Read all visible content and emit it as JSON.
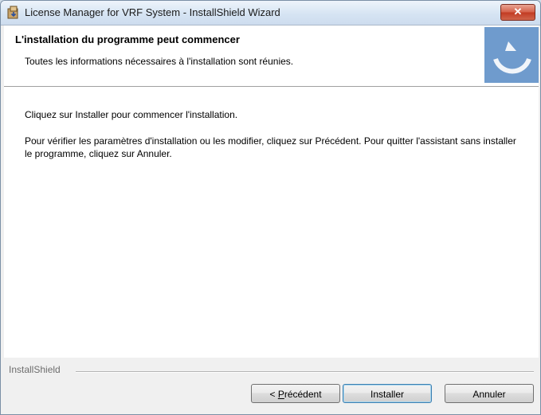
{
  "window": {
    "title": "License Manager for VRF System - InstallShield Wizard",
    "close_glyph": "✕",
    "icon": "installer-icon"
  },
  "header": {
    "title": "L'installation du programme peut commencer",
    "subtitle": "Toutes les informations nécessaires à l'installation sont réunies.",
    "logo": "installshield-logo-icon"
  },
  "body": {
    "paragraph1": "Cliquez sur Installer pour commencer l'installation.",
    "paragraph2": "Pour vérifier les paramètres d'installation ou les modifier, cliquez sur Précédent. Pour quitter l'assistant sans installer le programme, cliquez sur Annuler."
  },
  "footer": {
    "brand": "InstallShield",
    "buttons": {
      "back_prefix": "< ",
      "back_mnemonic": "P",
      "back_rest": "récédent",
      "install": "Installer",
      "cancel": "Annuler"
    }
  }
}
